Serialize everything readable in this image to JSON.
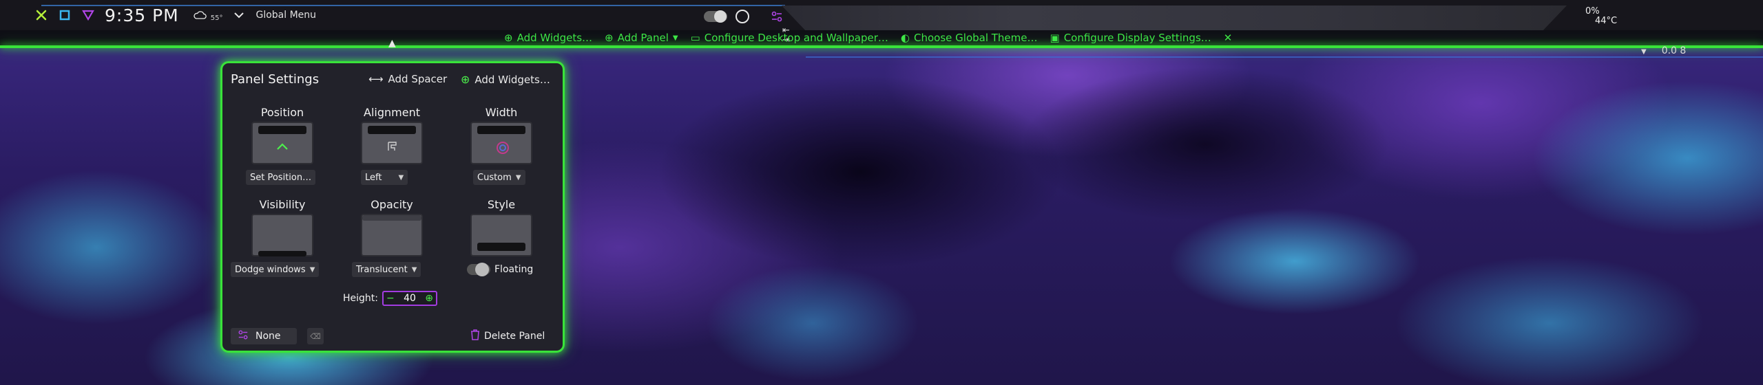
{
  "topbar": {
    "clock": "9:35 PM",
    "weather_temp": "55°",
    "global_menu": "Global Menu",
    "battery": "0%",
    "cpu_temp": "44°C",
    "icons": [
      "close-icon",
      "square-icon",
      "triangle-icon",
      "cloud-icon",
      "chevron-down-icon",
      "toggle-icon",
      "circle-icon",
      "sliders-icon"
    ]
  },
  "edit_toolbar": {
    "items": [
      {
        "label": "Add Widgets…",
        "icon": "plus-circle-icon"
      },
      {
        "label": "Add Panel",
        "icon": "plus-circle-icon"
      },
      {
        "label": "Configure Desktop and Wallpaper…",
        "icon": "desktop-icon"
      },
      {
        "label": "Choose Global Theme…",
        "icon": "theme-icon"
      },
      {
        "label": "Configure Display Settings…",
        "icon": "display-icon"
      }
    ],
    "right_control": "0.0 8"
  },
  "panel_settings": {
    "title": "Panel Settings",
    "add_spacer": "Add Spacer",
    "add_widgets": "Add Widgets…",
    "sections": [
      {
        "label": "Position",
        "value": "Set Position…"
      },
      {
        "label": "Alignment",
        "value": "Left"
      },
      {
        "label": "Width",
        "value": "Custom"
      },
      {
        "label": "Visibility",
        "value": "Dodge windows"
      },
      {
        "label": "Opacity",
        "value": "Translucent"
      },
      {
        "label": "Style",
        "value": "Floating"
      }
    ],
    "height_label": "Height:",
    "height_value": "40",
    "none_label": "None",
    "delete_label": "Delete Panel",
    "accent_color": "#39e33a",
    "highlight_color": "#a23ce0"
  }
}
